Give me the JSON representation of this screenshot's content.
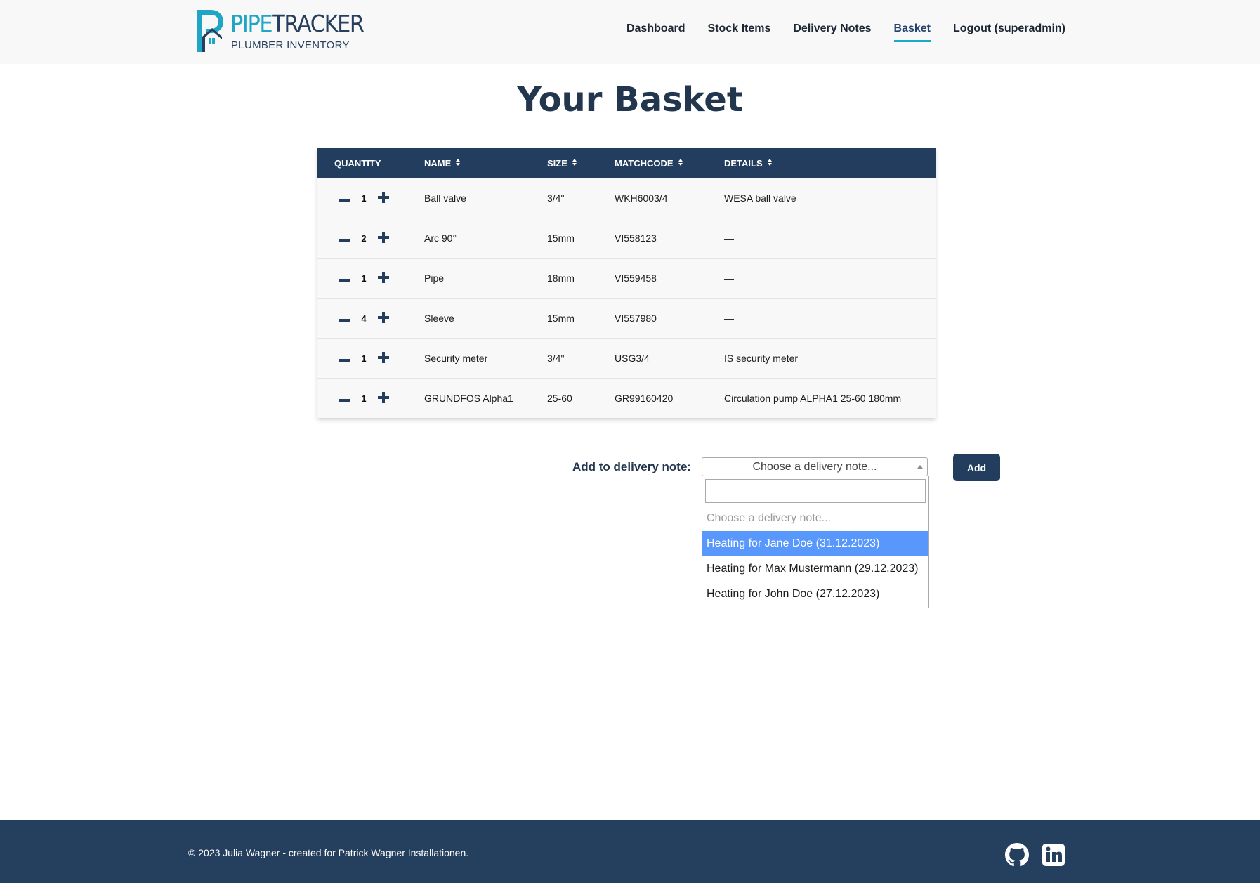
{
  "brand": {
    "title_part1": "PIPE",
    "title_part2": "TRACKER",
    "subtitle": "PLUMBER INVENTORY"
  },
  "nav": [
    {
      "label": "Dashboard",
      "active": false
    },
    {
      "label": "Stock Items",
      "active": false
    },
    {
      "label": "Delivery Notes",
      "active": false
    },
    {
      "label": "Basket",
      "active": true
    },
    {
      "label": "Logout (superadmin)",
      "active": false
    }
  ],
  "page": {
    "title": "Your Basket"
  },
  "table": {
    "headers": {
      "quantity": "QUANTITY",
      "name": "NAME",
      "size": "SIZE",
      "matchcode": "MATCHCODE",
      "details": "DETAILS"
    },
    "rows": [
      {
        "quantity": "1",
        "name": "Ball valve",
        "size": "3/4\"",
        "matchcode": "WKH6003/4",
        "details": "WESA ball valve"
      },
      {
        "quantity": "2",
        "name": "Arc 90°",
        "size": "15mm",
        "matchcode": "VI558123",
        "details": "—"
      },
      {
        "quantity": "1",
        "name": "Pipe",
        "size": "18mm",
        "matchcode": "VI559458",
        "details": "—"
      },
      {
        "quantity": "4",
        "name": "Sleeve",
        "size": "15mm",
        "matchcode": "VI557980",
        "details": "—"
      },
      {
        "quantity": "1",
        "name": "Security meter",
        "size": "3/4\"",
        "matchcode": "USG3/4",
        "details": "IS security meter"
      },
      {
        "quantity": "1",
        "name": "GRUNDFOS Alpha1",
        "size": "25-60",
        "matchcode": "GR99160420",
        "details": "Circulation pump ALPHA1 25-60 180mm"
      }
    ]
  },
  "delivery_note": {
    "label": "Add to delivery note:",
    "selected": "Choose a delivery note...",
    "search_value": "",
    "options": [
      {
        "label": "Choose a delivery note...",
        "placeholder": true,
        "highlighted": false
      },
      {
        "label": "Heating for Jane Doe (31.12.2023)",
        "placeholder": false,
        "highlighted": true
      },
      {
        "label": "Heating for Max Mustermann (29.12.2023)",
        "placeholder": false,
        "highlighted": false
      },
      {
        "label": "Heating for John Doe (27.12.2023)",
        "placeholder": false,
        "highlighted": false
      }
    ],
    "add_label": "Add"
  },
  "footer": {
    "text": "© 2023 Julia Wagner - created for Patrick Wagner Installationen.",
    "icons": [
      "github-icon",
      "linkedin-icon"
    ]
  },
  "colors": {
    "navy": "#233d5e",
    "accent": "#1aa9c8",
    "highlight": "#5897fb"
  }
}
